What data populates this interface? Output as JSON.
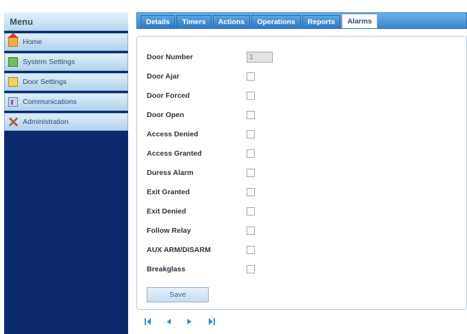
{
  "sidebar": {
    "title": "Menu",
    "items": [
      {
        "label": "Home",
        "icon": "home-icon"
      },
      {
        "label": "System Settings",
        "icon": "system-settings-icon"
      },
      {
        "label": "Door Settings",
        "icon": "door-icon"
      },
      {
        "label": "Communications",
        "icon": "communications-icon"
      },
      {
        "label": "Administration",
        "icon": "tools-icon"
      }
    ]
  },
  "tabs": [
    {
      "label": "Details"
    },
    {
      "label": "Timers"
    },
    {
      "label": "Actions"
    },
    {
      "label": "Operations"
    },
    {
      "label": "Reports"
    },
    {
      "label": "Alarms",
      "active": true
    }
  ],
  "form": {
    "door_number_label": "Door Number",
    "door_number_value": "1",
    "alarms": [
      {
        "label": "Door Ajar",
        "checked": false
      },
      {
        "label": "Door Forced",
        "checked": false
      },
      {
        "label": "Door Open",
        "checked": false
      },
      {
        "label": "Access Denied",
        "checked": false
      },
      {
        "label": "Access Granted",
        "checked": false
      },
      {
        "label": "Duress Alarm",
        "checked": false
      },
      {
        "label": "Exit Granted",
        "checked": false
      },
      {
        "label": "Exit Denied",
        "checked": false
      },
      {
        "label": "Follow Relay",
        "checked": false
      },
      {
        "label": "AUX ARM/DISARM",
        "checked": false
      },
      {
        "label": "Breakglass",
        "checked": false
      }
    ],
    "save_label": "Save"
  },
  "pager": {
    "icons": [
      "first-page-icon",
      "previous-page-icon",
      "next-page-icon",
      "last-page-icon"
    ],
    "color": "#2f8fd8"
  },
  "colors": {
    "sidebar_bg": "#0b2a6e",
    "tab_bar": "#3a86cf"
  }
}
